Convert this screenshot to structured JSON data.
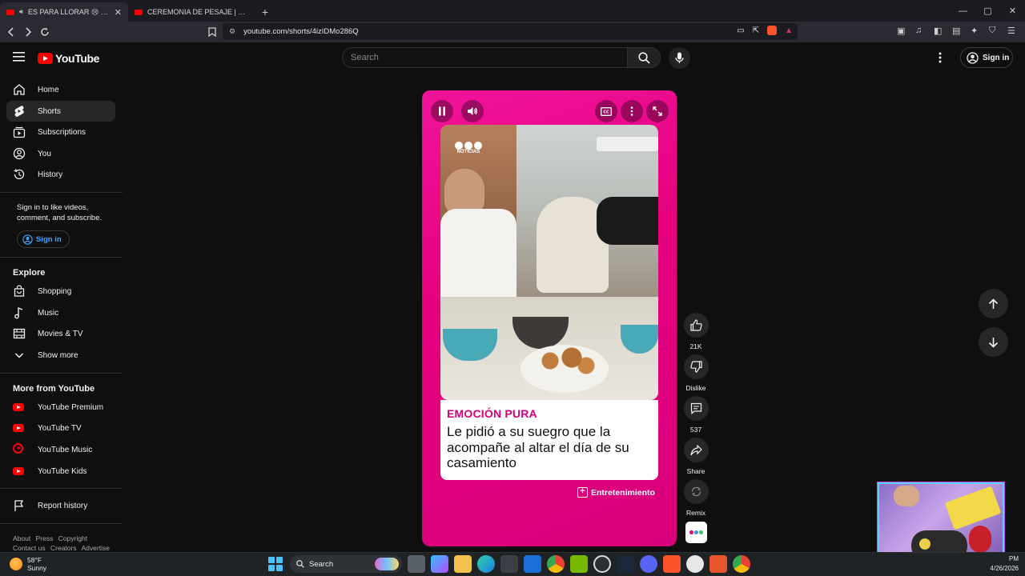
{
  "browser": {
    "tabs": [
      {
        "title": "ES PARA LLORAR 😢 - YouTube",
        "active": true
      },
      {
        "title": "CEREMONIA DE PESAJE | SUPERNOVA",
        "active": false
      }
    ],
    "new_tab": "+",
    "url": "youtube.com/shorts/4izIDMo286Q"
  },
  "yt_header": {
    "logo_text": "YouTube",
    "search_placeholder": "Search",
    "signin_label": "Sign in"
  },
  "sidebar": {
    "main_items": [
      {
        "label": "Home",
        "icon": "home-icon"
      },
      {
        "label": "Shorts",
        "icon": "shorts-icon"
      },
      {
        "label": "Subscriptions",
        "icon": "subscriptions-icon"
      },
      {
        "label": "You",
        "icon": "you-icon"
      },
      {
        "label": "History",
        "icon": "history-icon"
      }
    ],
    "signin_prompt": "Sign in to like videos, comment, and subscribe.",
    "signin_button": "Sign in",
    "explore_heading": "Explore",
    "explore_items": [
      {
        "label": "Shopping",
        "icon": "shopping-icon"
      },
      {
        "label": "Music",
        "icon": "music-icon"
      },
      {
        "label": "Movies & TV",
        "icon": "movies-icon"
      },
      {
        "label": "Show more",
        "icon": "chevron-down-icon"
      }
    ],
    "more_heading": "More from YouTube",
    "more_items": [
      {
        "label": "YouTube Premium"
      },
      {
        "label": "YouTube TV"
      },
      {
        "label": "YouTube Music"
      },
      {
        "label": "YouTube Kids"
      }
    ],
    "report_history": "Report history",
    "footer": [
      "About",
      "Press",
      "Copyright",
      "Contact us",
      "Creators",
      "Advertise"
    ]
  },
  "short": {
    "channel_watermark": "NOTICIAS",
    "caption_kicker": "EMOCIÓN PURA",
    "caption_text": "Le pidió a su suegro que la acompañe al altar el día de su casamiento",
    "category": "Entretenimiento",
    "accent_color": "#e6007e"
  },
  "actions": {
    "like_count": "21K",
    "dislike_label": "Dislike",
    "comment_count": "537",
    "share_label": "Share",
    "remix_label": "Remix"
  },
  "taskbar": {
    "temp": "58°F",
    "condition": "Sunny",
    "search_label": "Search",
    "time": "PM",
    "date": "4/26/2026"
  }
}
